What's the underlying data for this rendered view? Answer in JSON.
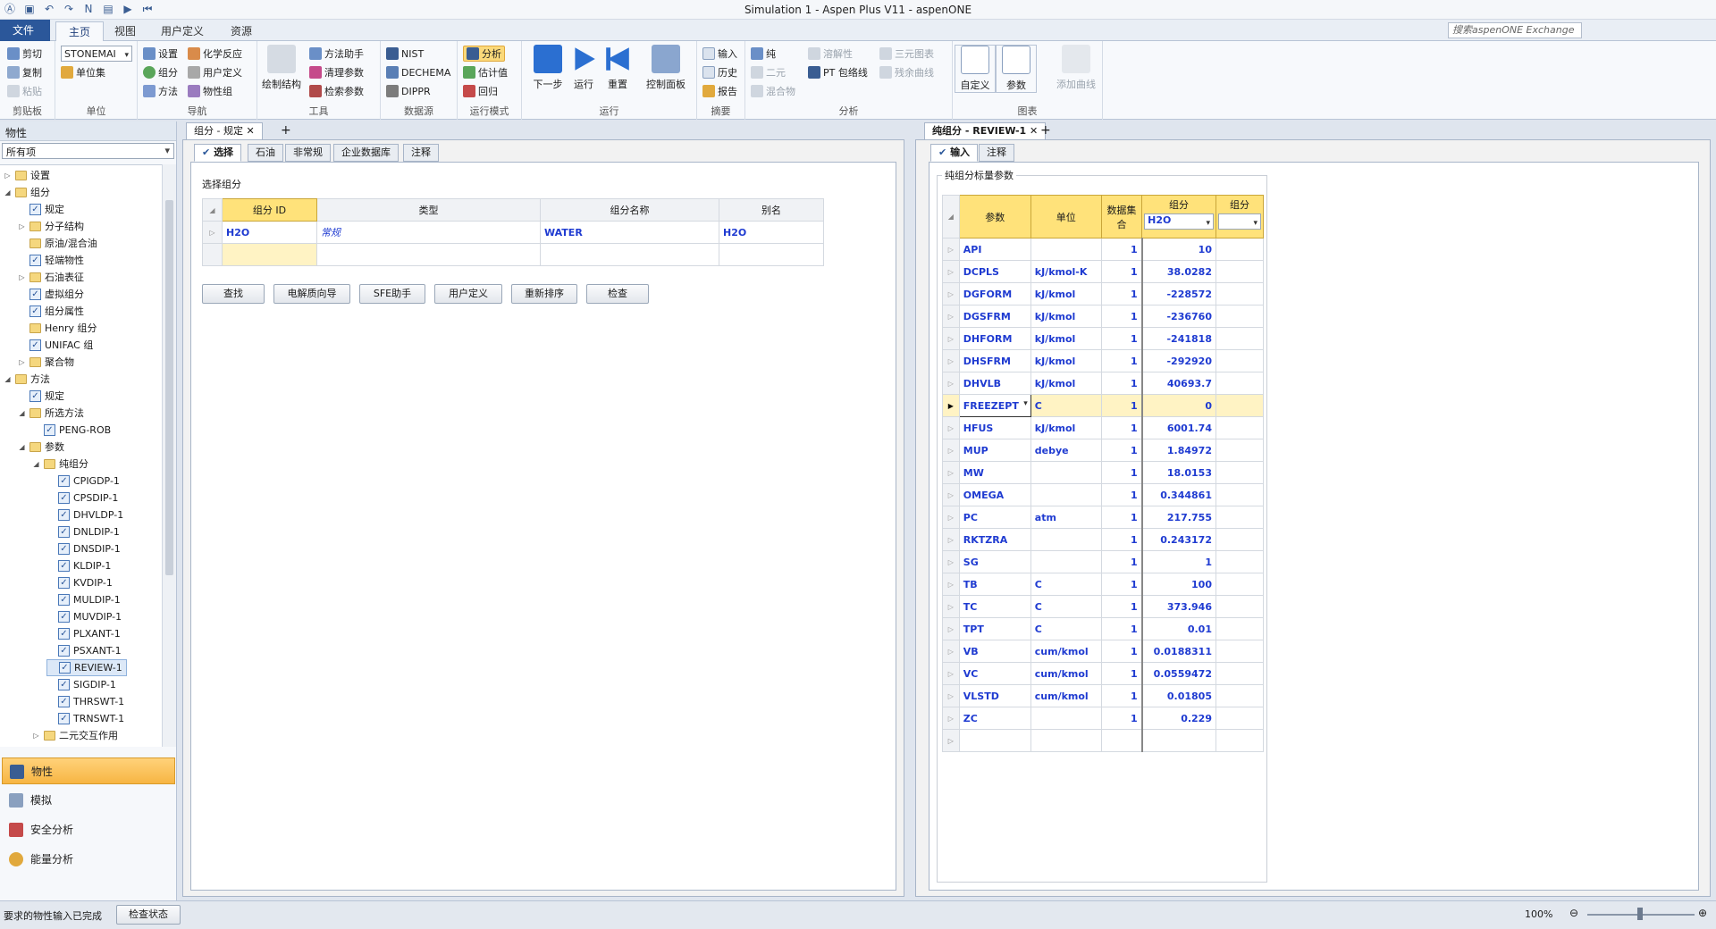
{
  "window": {
    "title": "Simulation 1 - Aspen Plus V11 - aspenONE"
  },
  "ribbon_tabs": [
    "文件",
    "主页",
    "视图",
    "用户定义",
    "资源"
  ],
  "search": {
    "placeholder": "搜索aspenONE Exchange"
  },
  "ribbon": {
    "clipboard": {
      "label": "剪贴板",
      "cut": "剪切",
      "copy": "复制",
      "paste": "粘贴"
    },
    "units": {
      "label": "单位",
      "unit_set_value": "STONEMAI",
      "unit_sets": "单位集"
    },
    "navigate": {
      "label": "导航",
      "setup": "设置",
      "components": "组分",
      "methods": "方法",
      "chem_reactions": "化学反应",
      "user_defined": "用户定义",
      "property_sets": "物性组"
    },
    "tools": {
      "label": "工具",
      "draw_structure": "绘制结构",
      "methods_assistant": "方法助手",
      "clean_params": "清理参数",
      "retrieve_params": "检索参数"
    },
    "data_source": {
      "label": "数据源",
      "nist": "NIST",
      "dechema": "DECHEMA",
      "dippr": "DIPPR"
    },
    "run_mode": {
      "label": "运行模式",
      "analysis": "分析",
      "estimation": "估计值",
      "regression": "回归"
    },
    "run": {
      "label": "运行",
      "next": "下一步",
      "run": "运行",
      "reset": "重置",
      "control_panel": "控制面板"
    },
    "summary": {
      "label": "摘要",
      "input": "输入",
      "history": "历史",
      "report": "报告"
    },
    "analysis": {
      "label": "分析",
      "pure": "纯",
      "binary": "二元",
      "mixture": "混合物",
      "solubility": "溶解性",
      "pt_envelope": "PT 包络线",
      "ternary": "三元图表",
      "residue": "残余曲线"
    },
    "charts": {
      "label": "图表",
      "custom": "自定义",
      "parameters": "参数",
      "add_curve": "添加曲线"
    }
  },
  "nav": {
    "title": "物性",
    "filter": "所有项",
    "tree": [
      {
        "label": "设置",
        "level": 0,
        "exp": "▷",
        "icon": "folder"
      },
      {
        "label": "组分",
        "level": 0,
        "exp": "◢",
        "icon": "folder"
      },
      {
        "label": "规定",
        "level": 1,
        "exp": "",
        "icon": "check"
      },
      {
        "label": "分子结构",
        "level": 1,
        "exp": "▷",
        "icon": "folder"
      },
      {
        "label": "原油/混合油",
        "level": 1,
        "exp": "",
        "icon": "folder"
      },
      {
        "label": "轻端物性",
        "level": 1,
        "exp": "",
        "icon": "check"
      },
      {
        "label": "石油表征",
        "level": 1,
        "exp": "▷",
        "icon": "folder"
      },
      {
        "label": "虚拟组分",
        "level": 1,
        "exp": "",
        "icon": "check"
      },
      {
        "label": "组分属性",
        "level": 1,
        "exp": "",
        "icon": "check"
      },
      {
        "label": "Henry 组分",
        "level": 1,
        "exp": "",
        "icon": "folder"
      },
      {
        "label": "UNIFAC 组",
        "level": 1,
        "exp": "",
        "icon": "check"
      },
      {
        "label": "聚合物",
        "level": 1,
        "exp": "▷",
        "icon": "folder"
      },
      {
        "label": "方法",
        "level": 0,
        "exp": "◢",
        "icon": "folder"
      },
      {
        "label": "规定",
        "level": 1,
        "exp": "",
        "icon": "check"
      },
      {
        "label": "所选方法",
        "level": 1,
        "exp": "◢",
        "icon": "folder"
      },
      {
        "label": "PENG-ROB",
        "level": 2,
        "exp": "",
        "icon": "check"
      },
      {
        "label": "参数",
        "level": 1,
        "exp": "◢",
        "icon": "folder"
      },
      {
        "label": "纯组分",
        "level": 2,
        "exp": "◢",
        "icon": "folder"
      },
      {
        "label": "CPIGDP-1",
        "level": 3,
        "exp": "",
        "icon": "check"
      },
      {
        "label": "CPSDIP-1",
        "level": 3,
        "exp": "",
        "icon": "check"
      },
      {
        "label": "DHVLDP-1",
        "level": 3,
        "exp": "",
        "icon": "check"
      },
      {
        "label": "DNLDIP-1",
        "level": 3,
        "exp": "",
        "icon": "check"
      },
      {
        "label": "DNSDIP-1",
        "level": 3,
        "exp": "",
        "icon": "check"
      },
      {
        "label": "KLDIP-1",
        "level": 3,
        "exp": "",
        "icon": "check"
      },
      {
        "label": "KVDIP-1",
        "level": 3,
        "exp": "",
        "icon": "check"
      },
      {
        "label": "MULDIP-1",
        "level": 3,
        "exp": "",
        "icon": "check"
      },
      {
        "label": "MUVDIP-1",
        "level": 3,
        "exp": "",
        "icon": "check"
      },
      {
        "label": "PLXANT-1",
        "level": 3,
        "exp": "",
        "icon": "check"
      },
      {
        "label": "PSXANT-1",
        "level": 3,
        "exp": "",
        "icon": "check"
      },
      {
        "label": "REVIEW-1",
        "level": 3,
        "exp": "",
        "icon": "check",
        "selected": true
      },
      {
        "label": "SIGDIP-1",
        "level": 3,
        "exp": "",
        "icon": "check"
      },
      {
        "label": "THRSWT-1",
        "level": 3,
        "exp": "",
        "icon": "check"
      },
      {
        "label": "TRNSWT-1",
        "level": 3,
        "exp": "",
        "icon": "check"
      },
      {
        "label": "二元交互作用",
        "level": 2,
        "exp": "▷",
        "icon": "folder"
      }
    ],
    "buttons": [
      "物性",
      "模拟",
      "安全分析",
      "能量分析"
    ]
  },
  "left_doc": {
    "tab": "组分 - 规定",
    "subtabs": [
      "选择",
      "石油",
      "非常规",
      "企业数据库",
      "注释"
    ],
    "section": "选择组分",
    "columns": [
      "组分 ID",
      "类型",
      "组分名称",
      "别名"
    ],
    "rows": [
      [
        "H2O",
        "常规",
        "WATER",
        "H2O"
      ]
    ],
    "buttons": [
      "查找",
      "电解质向导",
      "SFE助手",
      "用户定义",
      "重新排序",
      "检查"
    ]
  },
  "right_doc": {
    "tab": "纯组分 - REVIEW-1",
    "subtabs": [
      "输入",
      "注释"
    ],
    "section": "纯组分标量参数",
    "columns": [
      "参数",
      "单位",
      "数据集合",
      "组分",
      "组分"
    ],
    "component_select": "H2O",
    "rows": [
      [
        "API",
        "",
        "1",
        "10"
      ],
      [
        "DCPLS",
        "kJ/kmol-K",
        "1",
        "38.0282"
      ],
      [
        "DGFORM",
        "kJ/kmol",
        "1",
        "-228572"
      ],
      [
        "DGSFRM",
        "kJ/kmol",
        "1",
        "-236760"
      ],
      [
        "DHFORM",
        "kJ/kmol",
        "1",
        "-241818"
      ],
      [
        "DHSFRM",
        "kJ/kmol",
        "1",
        "-292920"
      ],
      [
        "DHVLB",
        "kJ/kmol",
        "1",
        "40693.7"
      ],
      [
        "FREEZEPT",
        "C",
        "1",
        "0"
      ],
      [
        "HFUS",
        "kJ/kmol",
        "1",
        "6001.74"
      ],
      [
        "MUP",
        "debye",
        "1",
        "1.84972"
      ],
      [
        "MW",
        "",
        "1",
        "18.0153"
      ],
      [
        "OMEGA",
        "",
        "1",
        "0.344861"
      ],
      [
        "PC",
        "atm",
        "1",
        "217.755"
      ],
      [
        "RKTZRA",
        "",
        "1",
        "0.243172"
      ],
      [
        "SG",
        "",
        "1",
        "1"
      ],
      [
        "TB",
        "C",
        "1",
        "100"
      ],
      [
        "TC",
        "C",
        "1",
        "373.946"
      ],
      [
        "TPT",
        "C",
        "1",
        "0.01"
      ],
      [
        "VB",
        "cum/kmol",
        "1",
        "0.0188311"
      ],
      [
        "VC",
        "cum/kmol",
        "1",
        "0.0559472"
      ],
      [
        "VLSTD",
        "cum/kmol",
        "1",
        "0.01805"
      ],
      [
        "ZC",
        "",
        "1",
        "0.229"
      ]
    ],
    "selected_row": 7
  },
  "status": {
    "message": "要求的物性输入已完成",
    "check_button": "检查状态",
    "zoom": "100%"
  },
  "colors": {
    "accent": "#2b579a",
    "highlight": "#ffe27a",
    "value_text": "#1f3bd1"
  }
}
